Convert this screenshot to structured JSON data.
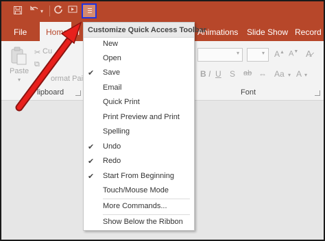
{
  "qat": {
    "save_icon": "floppy-disk-icon",
    "undo_icon": "undo-icon",
    "redo_icon": "redo-icon",
    "slideshow_icon": "start-from-beginning-icon",
    "customize_icon": "customize-qat-icon",
    "highlight_color": "#1e33e0"
  },
  "tabs": {
    "file": "File",
    "home": "Home",
    "insert": "I",
    "animations": "Animations",
    "slide_show": "Slide Show",
    "record": "Record"
  },
  "ribbon": {
    "paste": "Paste",
    "cut": "Cu",
    "format_painter": "ormat Paint",
    "clipboard": "lipboard",
    "font": "Font",
    "bold": "B",
    "italic": "I",
    "underline": "U",
    "strike": "S",
    "shadow": "ab"
  },
  "menu": {
    "title": "Customize Quick Access Toolbar",
    "items": [
      {
        "label": "New",
        "checked": false
      },
      {
        "label": "Open",
        "checked": false
      },
      {
        "label": "Save",
        "checked": true
      },
      {
        "label": "Email",
        "checked": false
      },
      {
        "label": "Quick Print",
        "checked": false
      },
      {
        "label": "Print Preview and Print",
        "checked": false
      },
      {
        "label": "Spelling",
        "checked": false
      },
      {
        "label": "Undo",
        "checked": true
      },
      {
        "label": "Redo",
        "checked": true
      },
      {
        "label": "Start From Beginning",
        "checked": true
      },
      {
        "label": "Touch/Mouse Mode",
        "checked": false
      },
      {
        "label": "More Commands...",
        "checked": false
      },
      {
        "label": "Show Below the Ribbon",
        "checked": false
      }
    ]
  },
  "colors": {
    "brand": "#b7472a",
    "arrow": "#e8201c"
  },
  "annotation": {
    "arrow_icon": "red-arrow-annotation"
  }
}
